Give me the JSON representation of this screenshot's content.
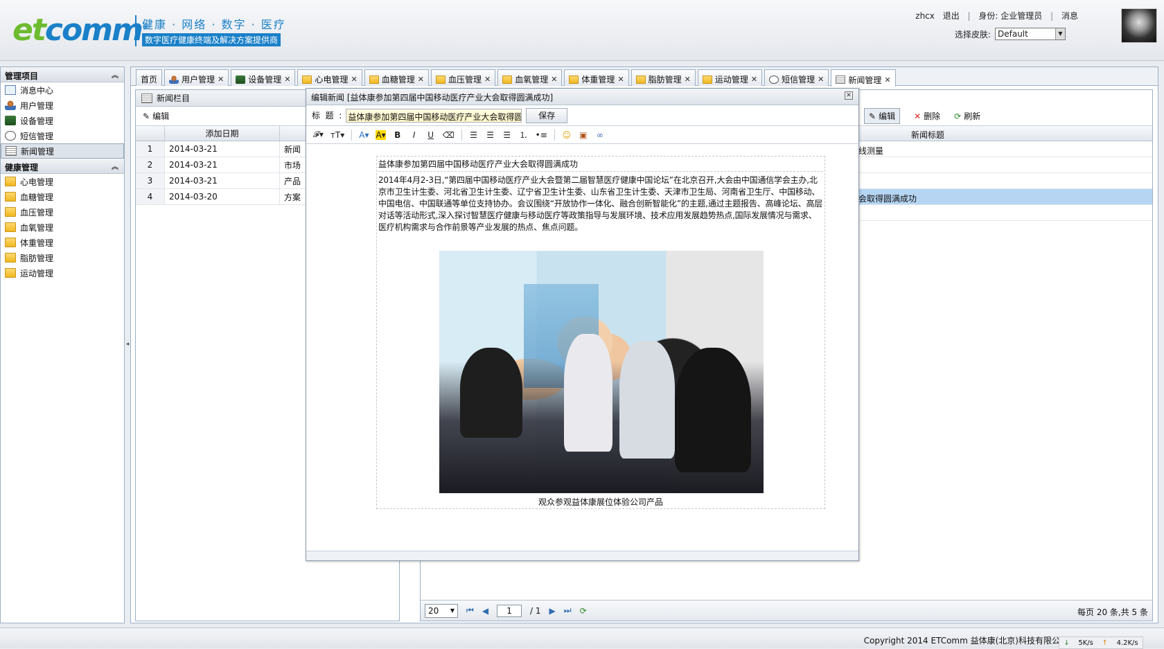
{
  "header": {
    "logo_text": "etcomm",
    "slogan_line1": "健康 · 网络 · 数字 · 医疗",
    "slogan_line2": "数字医疗健康终端及解决方案提供商",
    "username": "zhcx",
    "logout": "退出",
    "role_label": "身份: 企业管理员",
    "messages": "消息",
    "skin_label": "选择皮肤:",
    "skin_value": "Default"
  },
  "sidebar": {
    "section1_title": "管理项目",
    "section1_items": [
      "消息中心",
      "用户管理",
      "设备管理",
      "短信管理",
      "新闻管理"
    ],
    "section2_title": "健康管理",
    "section2_items": [
      "心电管理",
      "血糖管理",
      "血压管理",
      "血氧管理",
      "体重管理",
      "脂肪管理",
      "运动管理"
    ]
  },
  "tabs": [
    "首页",
    "用户管理",
    "设备管理",
    "心电管理",
    "血糖管理",
    "血压管理",
    "血氧管理",
    "体重管理",
    "脂肪管理",
    "运动管理",
    "短信管理",
    "新闻管理"
  ],
  "left_panel": {
    "title": "新闻栏目",
    "edit": "编辑",
    "col_date": "添加日期",
    "rows": [
      {
        "num": "1",
        "date": "2014-03-21",
        "name": "新闻"
      },
      {
        "num": "2",
        "date": "2014-03-21",
        "name": "市场"
      },
      {
        "num": "3",
        "date": "2014-03-21",
        "name": "产品"
      },
      {
        "num": "4",
        "date": "2014-03-20",
        "name": "方案"
      }
    ]
  },
  "right_panel": {
    "edit": "编辑",
    "delete": "删除",
    "refresh": "刷新",
    "col_title": "新闻标题",
    "rows": [
      "在线测量",
      "",
      "",
      "大会取得圆满成功",
      ""
    ]
  },
  "pager": {
    "page_size": "20",
    "page": "1",
    "total_pages": "/ 1",
    "status": "每页 20 条,共 5 条"
  },
  "dialog": {
    "title": "编辑新闻 [益体康参加第四届中国移动医疗产业大会取得圆满成功]",
    "title_label": "标  题  :",
    "title_value": "益体康参加第四届中国移动医疗产业大会取得圆满成功",
    "save": "保存",
    "article_title": "益体康参加第四届中国移动医疗产业大会取得圆满成功",
    "article_body": "2014年4月2-3日,“第四届中国移动医疗产业大会暨第二届智慧医疗健康中国论坛”在北京召开,大会由中国通信学会主办,北京市卫生计生委、河北省卫生计生委、辽宁省卫生计生委、山东省卫生计生委、天津市卫生局、河南省卫生厅、中国移动、中国电信、中国联通等单位支持协办。会议围绕“开放协作一体化、融合创新智能化”的主题,通过主题报告、高峰论坛、高层对话等活动形式,深入探讨智慧医疗健康与移动医疗等政策指导与发展环境、技术应用发展趋势热点,国际发展情况与需求、医疗机构需求与合作前景等产业发展的热点、焦点问题。",
    "caption": "观众参观益体康展位体验公司产品"
  },
  "footer": {
    "copyright": "Copyright 2014 ETComm 益体康(北京)科技有限公",
    "down_speed": "5K/s",
    "up_speed": "4.2K/s"
  }
}
